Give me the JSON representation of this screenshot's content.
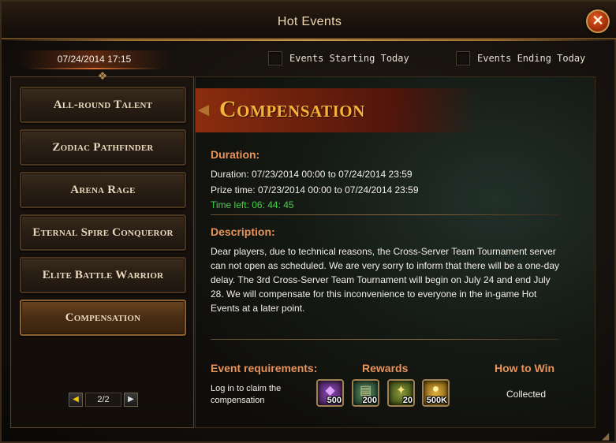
{
  "window": {
    "title": "Hot Events"
  },
  "header": {
    "date": "07/24/2014 17:15",
    "filters": [
      {
        "label": "Events Starting Today",
        "checked": false
      },
      {
        "label": "Events Ending Today",
        "checked": false
      }
    ]
  },
  "sidebar": {
    "events": [
      {
        "label": "All-round Talent"
      },
      {
        "label": "Zodiac Pathfinder"
      },
      {
        "label": "Arena Rage"
      },
      {
        "label": "Eternal Spire Conqueror"
      },
      {
        "label": "Elite Battle Warrior"
      },
      {
        "label": "Compensation",
        "active": true
      }
    ],
    "pager": {
      "text": "2/2"
    }
  },
  "detail": {
    "banner_title": "Compensation",
    "duration_heading": "Duration:",
    "duration_line": "Duration: 07/23/2014 00:00 to 07/24/2014 23:59",
    "prize_line": "Prize time: 07/23/2014 00:00 to 07/24/2014 23:59",
    "time_left": "Time left: 06: 44: 45",
    "description_heading": "Description:",
    "description": "Dear players, due to technical reasons, the Cross-Server Team Tournament server can not open as scheduled. We are very sorry to inform that there will be a one-day delay. The 3rd Cross-Server Team Tournament will begin on July 24 and end July 28. We will compensate for this inconvenience to everyone in the in-game Hot Events at a later point.",
    "requirements_heading": "Event requirements:",
    "rewards_heading": "Rewards",
    "howtowin_heading": "How to Win",
    "requirement_text": "Log in to claim the compensation",
    "rewards": [
      {
        "qty": "500",
        "icon": "purple-gem-icon",
        "color": "#5a2a7a"
      },
      {
        "qty": "200",
        "icon": "scroll-icon",
        "color": "#3a5a3a"
      },
      {
        "qty": "20",
        "icon": "crystal-icon",
        "color": "#4a5a2a"
      },
      {
        "qty": "500K",
        "icon": "gold-coin-icon",
        "color": "#6a5010"
      }
    ],
    "status": "Collected"
  },
  "colors": {
    "accent_orange": "#e8935a",
    "banner_gold": "#f5b33a",
    "time_green": "#46d24a",
    "close_red": "#c8400f"
  }
}
